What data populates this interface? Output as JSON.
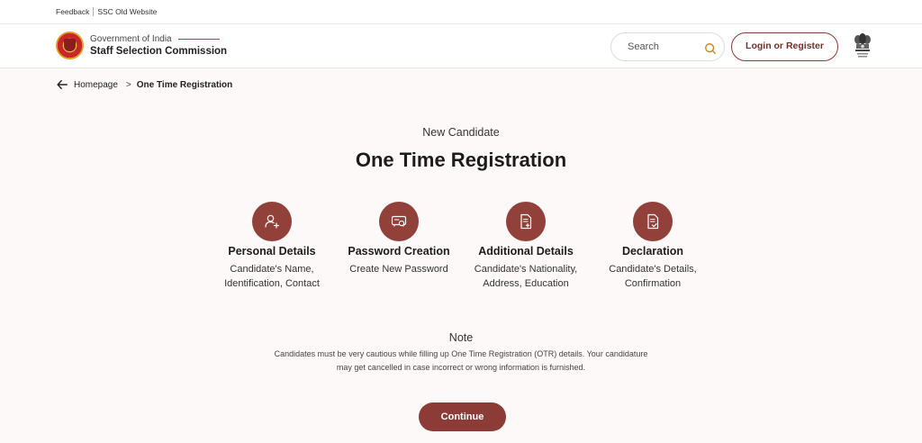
{
  "topbar": {
    "feedback": "Feedback",
    "old_site": "SSC Old Website"
  },
  "header": {
    "org_line1": "Government of India",
    "org_line2": "Staff Selection Commission",
    "search_placeholder": "Search",
    "login_label": "Login or Register"
  },
  "breadcrumb": {
    "home": "Homepage",
    "separator": ">",
    "current": "One Time Registration"
  },
  "page": {
    "subtitle": "New Candidate",
    "title": "One Time Registration"
  },
  "steps": [
    {
      "title": "Personal Details",
      "desc": "Candidate's Name, Identification, Contact",
      "icon": "user-add-icon"
    },
    {
      "title": "Password Creation",
      "desc": "Create New Password",
      "icon": "password-card-icon"
    },
    {
      "title": "Additional Details",
      "desc": "Candidate's Nationality, Address, Education",
      "icon": "document-add-icon"
    },
    {
      "title": "Declaration",
      "desc": "Candidate's Details, Confirmation",
      "icon": "document-check-icon"
    }
  ],
  "note": {
    "title": "Note",
    "text": "Candidates must be very cautious while filling up One Time Registration (OTR) details. Your candidature may get cancelled in case incorrect or wrong information is furnished."
  },
  "continue_label": "Continue",
  "colors": {
    "accent": "#8c3b36",
    "background": "#fdf9f8",
    "search_icon": "#c8862a"
  }
}
